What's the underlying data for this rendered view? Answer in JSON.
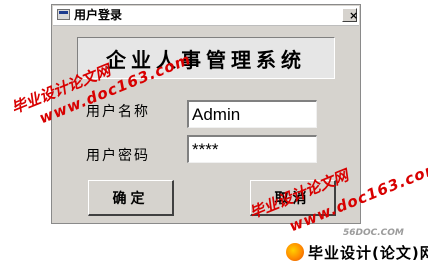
{
  "window": {
    "title": "用户登录",
    "close_glyph": "×"
  },
  "banner": {
    "text": "企业人事管理系统"
  },
  "form": {
    "username_label": "用户名称",
    "username_value": "Admin",
    "password_label": "用户密码",
    "password_value": "****"
  },
  "buttons": {
    "ok_label": "确定",
    "cancel_label": "取消"
  },
  "watermarks": {
    "site_url": "www.doc163.com",
    "site_name": "毕业设计论文网",
    "corner_site": "56DOC.COM",
    "logo_text": "毕业设计(论文)网"
  }
}
